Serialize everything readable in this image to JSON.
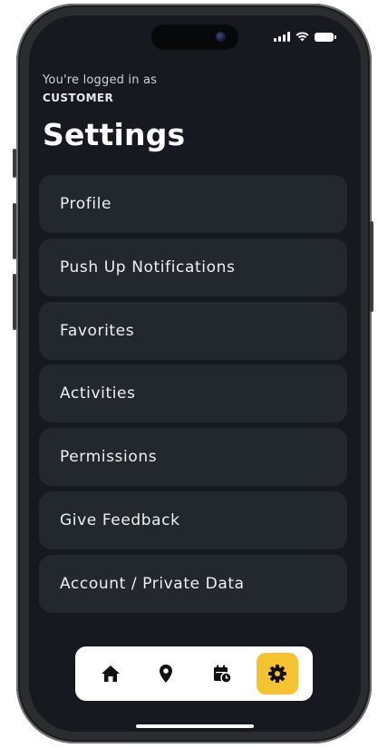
{
  "header": {
    "logged_in_text": "You're logged in as",
    "role": "CUSTOMER",
    "title": "Settings"
  },
  "menu": {
    "items": [
      {
        "label": "Profile"
      },
      {
        "label": "Push Up Notifications"
      },
      {
        "label": "Favorites"
      },
      {
        "label": "Activities"
      },
      {
        "label": "Permissions"
      },
      {
        "label": "Give Feedback"
      },
      {
        "label": "Account / Private Data"
      }
    ]
  },
  "tabbar": {
    "tabs": [
      {
        "icon": "home-icon",
        "active": false
      },
      {
        "icon": "location-pin-icon",
        "active": false
      },
      {
        "icon": "calendar-clock-icon",
        "active": false
      },
      {
        "icon": "gear-icon",
        "active": true
      }
    ],
    "active_color": "#f5c230"
  },
  "theme": {
    "background": "#161a20",
    "card": "#23272e",
    "text": "#eef0f2"
  }
}
